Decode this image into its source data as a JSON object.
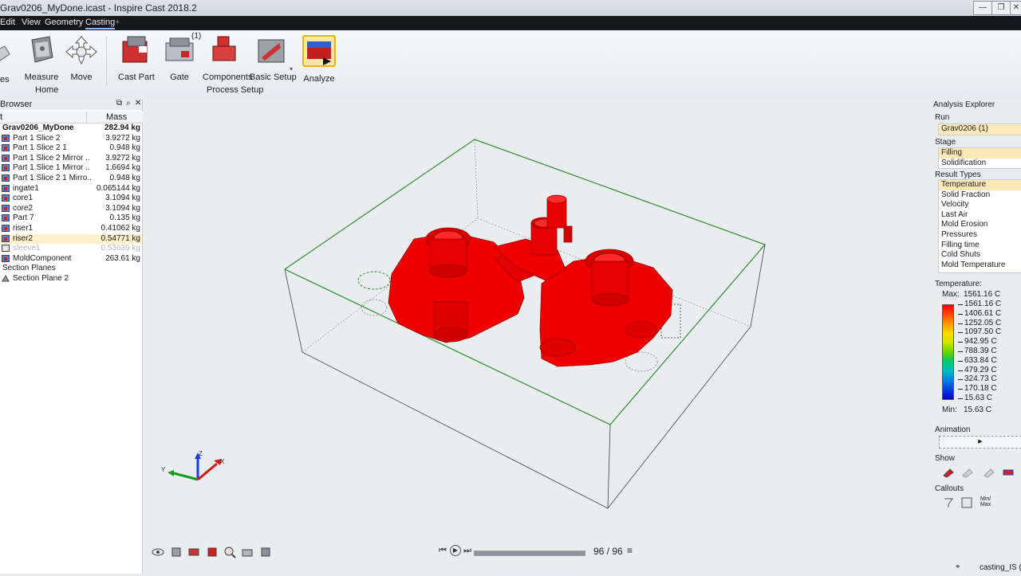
{
  "window": {
    "title": "Grav0206_MyDone.icast - Inspire Cast 2018.2",
    "controls": [
      "—",
      "❐",
      "✕"
    ]
  },
  "menu": {
    "items": [
      "Edit",
      "View",
      "Geometry",
      "Casting"
    ],
    "add": "+"
  },
  "ribbon": {
    "tools": [
      {
        "label": "Measure",
        "icon": "measure-icon"
      },
      {
        "label": "Move",
        "icon": "move-icon"
      },
      {
        "label": "Cast Part",
        "icon": "cast-part-icon"
      },
      {
        "label": "Gate",
        "icon": "gate-icon",
        "badge": "(1)"
      },
      {
        "label": "Components",
        "icon": "components-icon"
      },
      {
        "label": "Basic Setup",
        "icon": "basic-setup-icon"
      },
      {
        "label": "Analyze",
        "icon": "analyze-icon"
      }
    ],
    "group_home": "Home",
    "group_process": "Process Setup",
    "truncated_left": "es"
  },
  "browser": {
    "title": "Browser",
    "col_name": "t",
    "col_mass": "Mass",
    "rows": [
      {
        "name": "Grav0206_MyDone",
        "mass": "282.94 kg",
        "style": "root"
      },
      {
        "name": "Part 1 Slice 2",
        "mass": "3.9272 kg",
        "style": "part"
      },
      {
        "name": "Part 1 Slice 2 1",
        "mass": "0.948 kg",
        "style": "part"
      },
      {
        "name": "Part 1 Slice 2 Mirror ..",
        "mass": "3.9272 kg",
        "style": "part"
      },
      {
        "name": "Part 1 Slice 1 Mirror ..",
        "mass": "1.6694 kg",
        "style": "part"
      },
      {
        "name": "Part 1 Slice 2 1 Mirro..",
        "mass": "0.948 kg",
        "style": "part"
      },
      {
        "name": "ingate1",
        "mass": "0.065144 kg",
        "style": "part"
      },
      {
        "name": "core1",
        "mass": "3.1094 kg",
        "style": "part"
      },
      {
        "name": "core2",
        "mass": "3.1094 kg",
        "style": "part"
      },
      {
        "name": "Part 7",
        "mass": "0.135 kg",
        "style": "part"
      },
      {
        "name": "riser1",
        "mass": "0.41062 kg",
        "style": "part"
      },
      {
        "name": "riser2",
        "mass": "0.54771 kg",
        "style": "selected"
      },
      {
        "name": "sleeve1",
        "mass": "0.53639 kg",
        "style": "dim"
      },
      {
        "name": "MoldComponent",
        "mass": "263.61 kg",
        "style": "part"
      },
      {
        "name": "Section Planes",
        "mass": "",
        "style": "group"
      },
      {
        "name": "Section Plane 2",
        "mass": "",
        "style": "plane"
      }
    ]
  },
  "playback": {
    "frame": "96 / 96",
    "progress": 1.0
  },
  "analysis": {
    "title": "Analysis Explorer",
    "run_label": "Run",
    "run_value": "Grav0206 (1)",
    "stage_label": "Stage",
    "stages": [
      "Filling",
      "Solidification"
    ],
    "stage_selected": "Filling",
    "result_types_label": "Result Types",
    "result_types": [
      "Temperature",
      "Solid Fraction",
      "Velocity",
      "Last Air",
      "Mold Erosion",
      "Pressures",
      "Filling time",
      "Cold Shuts",
      "Mold Temperature"
    ],
    "result_selected": "Temperature",
    "legend_title": "Temperature:",
    "max_label": "Max:",
    "max_value": "1561.16 C",
    "min_label": "Min:",
    "min_value": "15.63 C",
    "legend_values": [
      "1561.16 C",
      "1406.61 C",
      "1252.05 C",
      "1097.50 C",
      "942.95 C",
      "788.39 C",
      "633.84 C",
      "479.29 C",
      "324.73 C",
      "170.18 C",
      "15.63 C"
    ],
    "legend_colors": [
      "#ff0000",
      "#ff4a00",
      "#ff9a00",
      "#ffd800",
      "#c8e600",
      "#66d400",
      "#00c86a",
      "#00b8c8",
      "#0080e0",
      "#0040d8",
      "#0000c8"
    ],
    "animation_label": "Animation",
    "show_label": "Show",
    "callouts_label": "Callouts",
    "minmax_label": "Min/ Max"
  },
  "status": {
    "text": "casting_IS (m"
  },
  "colors": {
    "casting_red": "#ee0000",
    "mold_box": "#2e8b2e"
  }
}
